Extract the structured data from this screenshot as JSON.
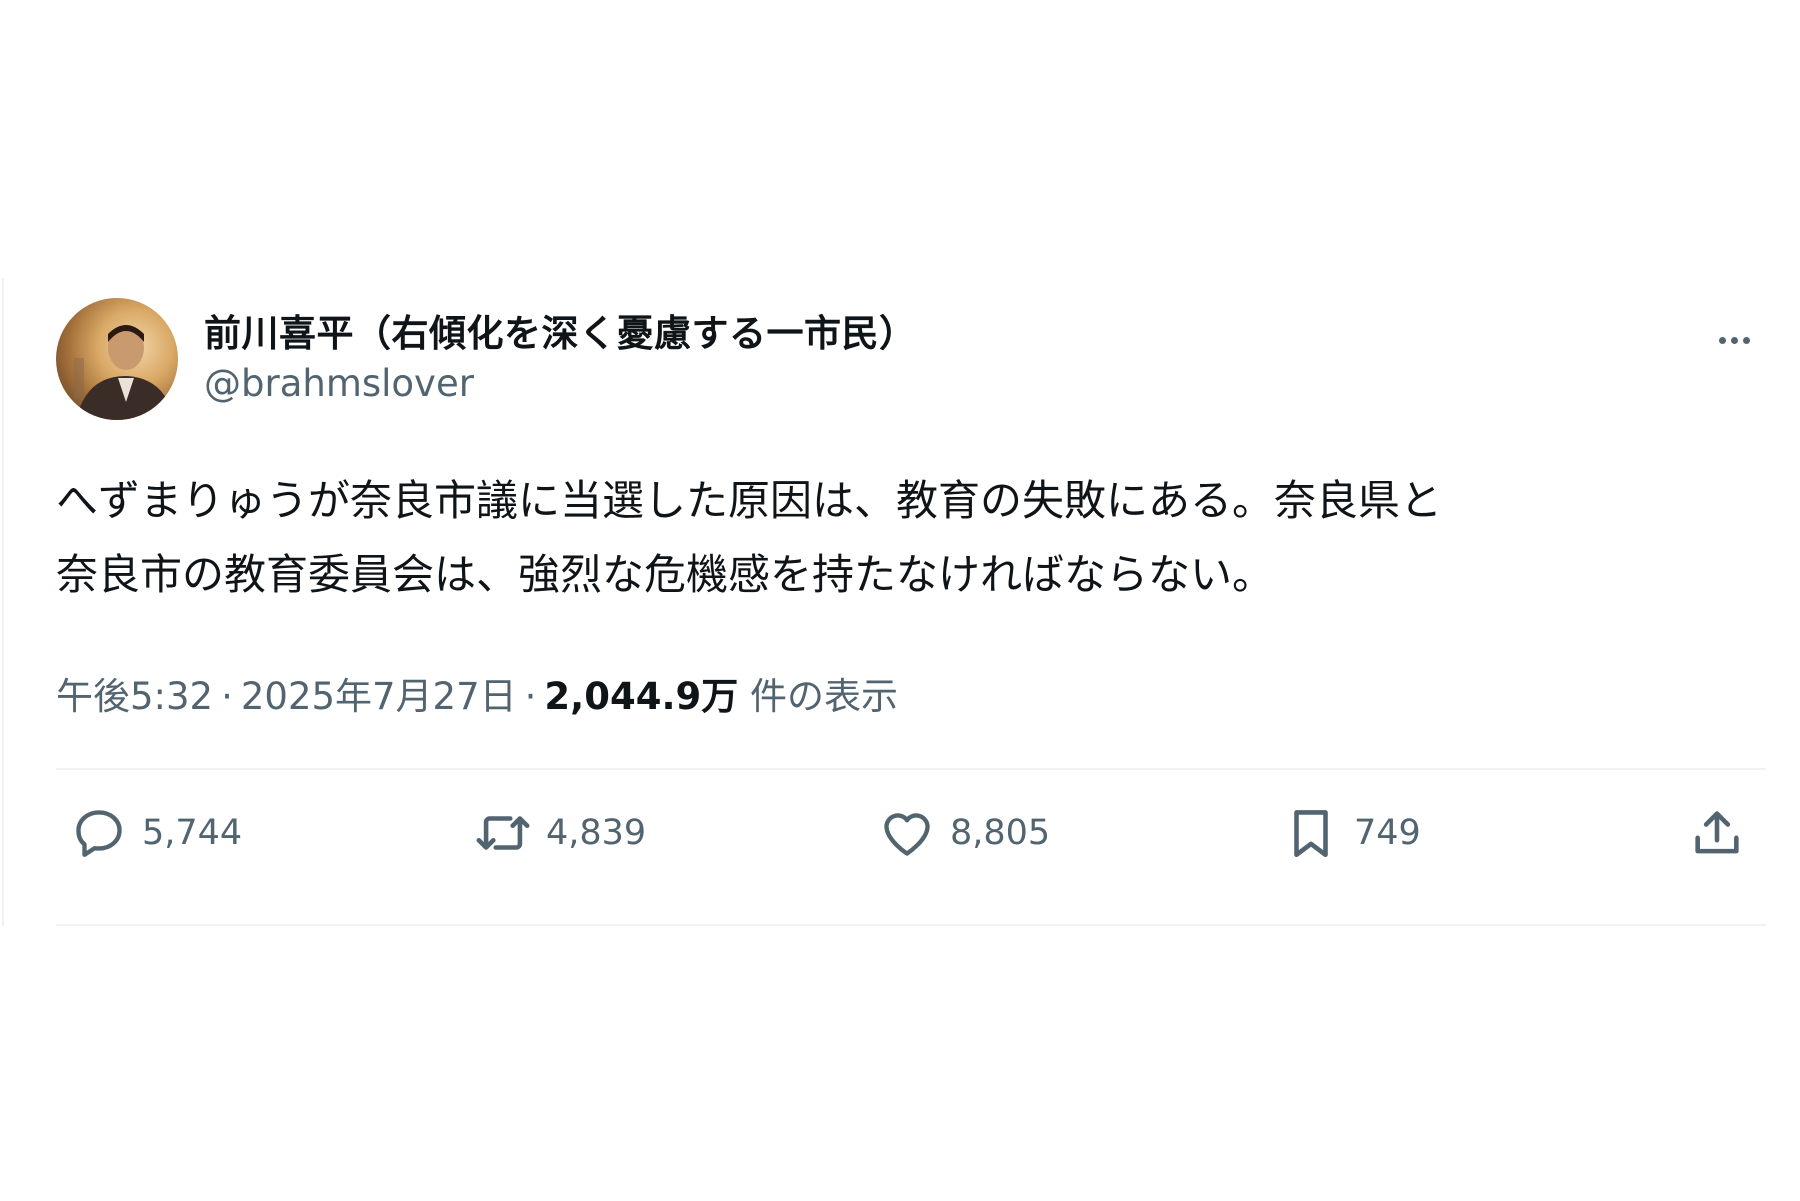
{
  "tweet": {
    "display_name": "前川喜平（右傾化を深く憂慮する一市民）",
    "handle": "@brahmslover",
    "text_line_1": "へずまりゅうが奈良市議に当選した原因は、教育の失敗にある。奈良県と",
    "text_line_2": "奈良市の教育委員会は、強烈な危機感を持たなければならない。",
    "time": "午後5:32",
    "date": "2025年7月27日",
    "views_count": "2,044.9万",
    "views_label": "件の表示",
    "separator": "·"
  },
  "actions": {
    "replies": "5,744",
    "reposts": "4,839",
    "likes": "8,805",
    "bookmarks": "749"
  },
  "icons": {
    "avatar": "profile-photo",
    "more": "more-icon",
    "reply": "reply-icon",
    "repost": "repost-icon",
    "like": "heart-icon",
    "bookmark": "bookmark-icon",
    "share": "share-icon"
  },
  "colors": {
    "text": "#0f1419",
    "secondary": "#536471",
    "divider": "#eff3f4"
  }
}
